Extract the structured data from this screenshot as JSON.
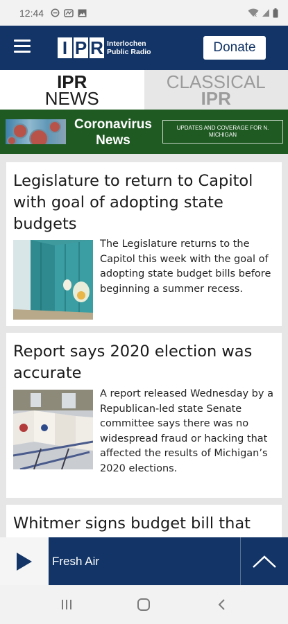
{
  "status": {
    "time": "12:44",
    "left_icons": [
      "do-not-disturb-icon",
      "gallery-icon",
      "image-icon"
    ],
    "right_icons": [
      "wifi-icon",
      "signal-icon",
      "battery-icon"
    ]
  },
  "header": {
    "menu_icon": "hamburger-icon",
    "logo_letters": [
      "I",
      "P",
      "R"
    ],
    "logo_line1": "Interlochen",
    "logo_line2": "Public Radio",
    "donate_label": "Donate",
    "colors": {
      "header_bg": "#123466",
      "banner_bg": "#1f5a22"
    }
  },
  "tabs": [
    {
      "line1": "IPR",
      "line2": "NEWS",
      "active": true
    },
    {
      "line1": "CLASSICAL",
      "line2": "IPR",
      "active": false
    }
  ],
  "banner": {
    "title_line1": "Coronavirus",
    "title_line2": "News",
    "subtitle": "UPDATES AND COVERAGE FOR N. MICHIGAN"
  },
  "articles": [
    {
      "headline": "Legislature to return to Capitol with goal of adopting state budgets",
      "summary": "The Legislature returns to the Capitol this week with the goal of adopting state budget bills before beginning a summer recess.",
      "image": "school-lockers-photo"
    },
    {
      "headline": "Report says 2020 election was accurate",
      "summary": "A report released Wednesday by a Republican-led state Senate committee says there was no widespread fraud or hacking that affected the results of Michigan’s 2020 elections.",
      "image": "voting-booths-photo"
    },
    {
      "headline": "Whitmer signs budget bill that"
    }
  ],
  "player": {
    "play_icon": "play-icon",
    "program": "Fresh Air",
    "expand_icon": "chevron-up-icon"
  },
  "nav": [
    "recent-apps-icon",
    "home-icon",
    "back-icon"
  ]
}
